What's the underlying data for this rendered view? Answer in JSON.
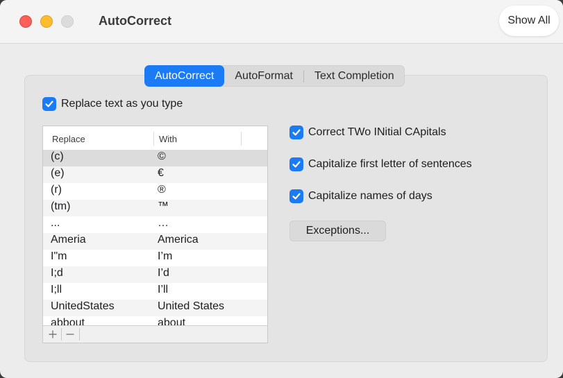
{
  "window": {
    "title": "AutoCorrect",
    "show_all_label": "Show All"
  },
  "tabs": [
    {
      "label": "AutoCorrect",
      "active": true
    },
    {
      "label": "AutoFormat",
      "active": false
    },
    {
      "label": "Text Completion",
      "active": false
    }
  ],
  "replace_text": {
    "label": "Replace text as you type",
    "checked": true
  },
  "table": {
    "headers": {
      "replace": "Replace",
      "with": "With"
    },
    "rows": [
      {
        "replace": "(c)",
        "with": "©"
      },
      {
        "replace": "(e)",
        "with": "€"
      },
      {
        "replace": "(r)",
        "with": "®"
      },
      {
        "replace": "(tm)",
        "with": "™"
      },
      {
        "replace": "...",
        "with": "…"
      },
      {
        "replace": "Ameria",
        "with": "America"
      },
      {
        "replace": "I\"m",
        "with": "I’m"
      },
      {
        "replace": "I;d",
        "with": "I’d"
      },
      {
        "replace": "I;ll",
        "with": "I’ll"
      },
      {
        "replace": "UnitedStates",
        "with": "United States"
      },
      {
        "replace": "abbout",
        "with": "about"
      }
    ]
  },
  "options": [
    {
      "label": "Correct TWo INitial CApitals",
      "checked": true
    },
    {
      "label": "Capitalize first letter of sentences",
      "checked": true
    },
    {
      "label": "Capitalize names of days",
      "checked": true
    }
  ],
  "exceptions_label": "Exceptions...",
  "colors": {
    "accent": "#1a7bf5",
    "window_bg": "#ececec"
  },
  "icons": {
    "add": "plus-icon",
    "remove": "minus-icon",
    "check": "checkmark-icon"
  }
}
